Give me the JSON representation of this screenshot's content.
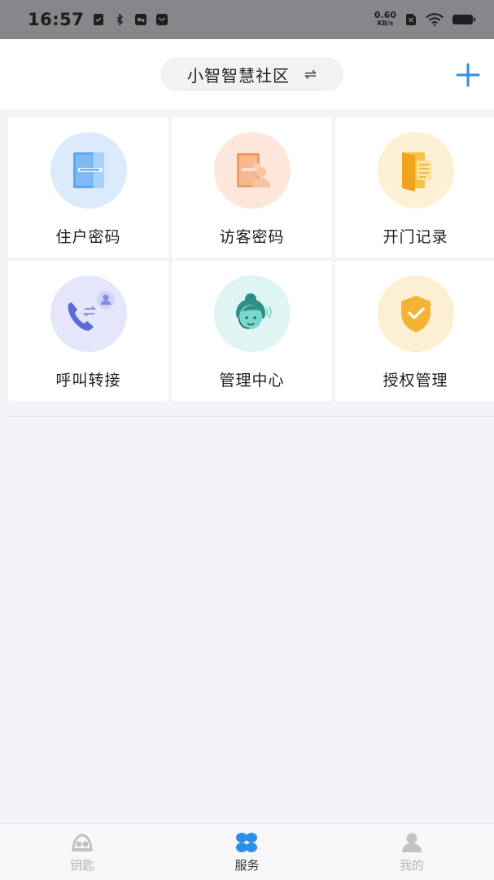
{
  "status_bar": {
    "time": "16:57",
    "net_speed_value": "0.60",
    "net_speed_unit": "KB/s"
  },
  "header": {
    "community_name": "小智智慧社区",
    "swap_symbol": "⇌",
    "add_symbol": "+"
  },
  "services": [
    {
      "label": "住户密码",
      "icon": "door-icon",
      "bg": "#dcebfb"
    },
    {
      "label": "访客密码",
      "icon": "visitor-door-icon",
      "bg": "#fde6da"
    },
    {
      "label": "开门记录",
      "icon": "open-door-log-icon",
      "bg": "#fdf0d4"
    },
    {
      "label": "呼叫转接",
      "icon": "call-transfer-icon",
      "bg": "#e5e6fa"
    },
    {
      "label": "管理中心",
      "icon": "service-agent-icon",
      "bg": "#def5f3"
    },
    {
      "label": "授权管理",
      "icon": "shield-check-icon",
      "bg": "#fdefd3"
    }
  ],
  "tab_bar": {
    "tabs": [
      {
        "label": "钥匙",
        "icon": "key-icon",
        "active": false
      },
      {
        "label": "服务",
        "icon": "services-grid-icon",
        "active": true
      },
      {
        "label": "我的",
        "icon": "profile-icon",
        "active": false
      }
    ]
  },
  "colors": {
    "accent": "#2b8fe8",
    "status_bar_bg": "#87878b",
    "page_bg": "#f4f3f8"
  }
}
